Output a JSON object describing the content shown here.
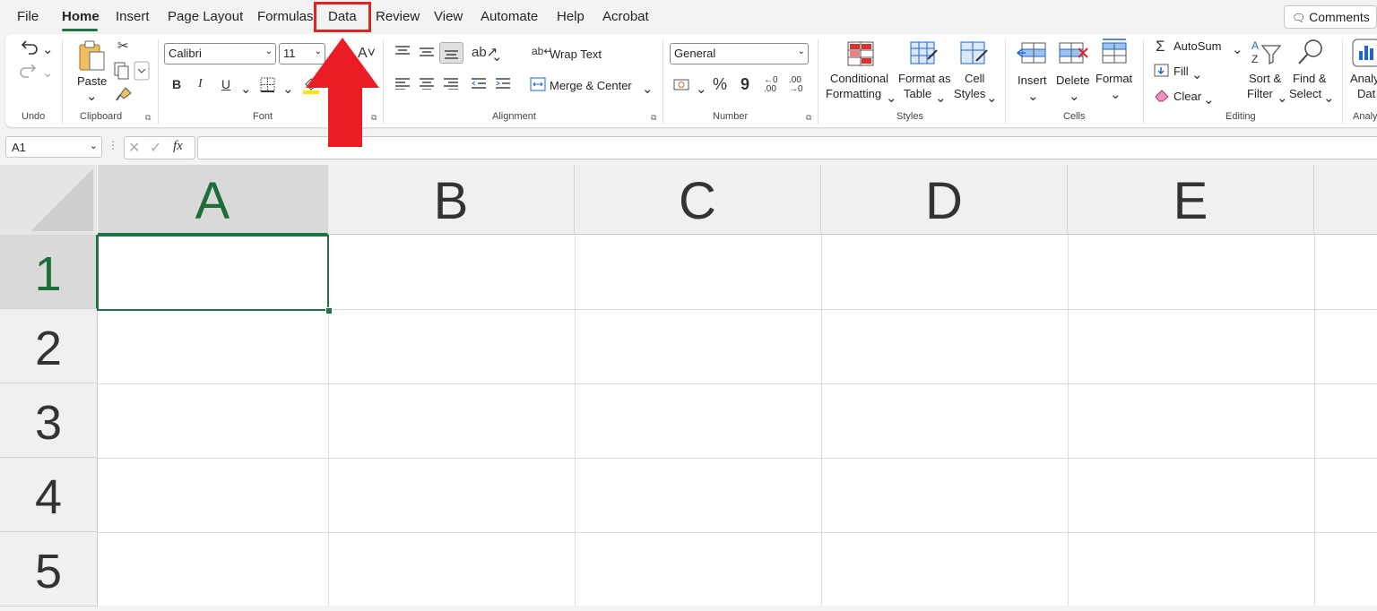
{
  "tabs": [
    "File",
    "Home",
    "Insert",
    "Page Layout",
    "Formulas",
    "Data",
    "Review",
    "View",
    "Automate",
    "Help",
    "Acrobat"
  ],
  "active_tab": "Home",
  "highlighted_tab": "Data",
  "comments_label": "Comments",
  "ribbon": {
    "groups": [
      "Undo",
      "Clipboard",
      "Font",
      "Alignment",
      "Number",
      "Styles",
      "Cells",
      "Editing",
      "Analy"
    ],
    "clipboard": {
      "paste": "Paste"
    },
    "font": {
      "name": "Calibri",
      "size": "11",
      "bold": "B",
      "italic": "I",
      "underline": "U"
    },
    "alignment": {
      "wrap": "Wrap Text",
      "merge": "Merge & Center"
    },
    "number": {
      "format": "General",
      "percent": "%",
      "comma": "9",
      "inc_dec": ".0\n.00",
      "dec_dec": ".00\n→.0"
    },
    "styles": {
      "conditional_1": "Conditional",
      "conditional_2": "Formatting",
      "format_as_1": "Format as",
      "format_as_2": "Table",
      "cell_styles_1": "Cell",
      "cell_styles_2": "Styles"
    },
    "cells": {
      "insert": "Insert",
      "delete": "Delete",
      "format": "Format"
    },
    "editing": {
      "autosum": "AutoSum",
      "fill": "Fill",
      "clear": "Clear",
      "sort_1": "Sort &",
      "sort_2": "Filter",
      "find_1": "Find &",
      "find_2": "Select"
    },
    "analyze": {
      "line1": "Analy",
      "line2": "Dat"
    }
  },
  "formula_bar": {
    "name_box": "A1",
    "fx": "fx",
    "value": ""
  },
  "columns": [
    "A",
    "B",
    "C",
    "D",
    "E"
  ],
  "rows": [
    "1",
    "2",
    "3",
    "4",
    "5"
  ],
  "selected_cell": "A1",
  "colors": {
    "accent": "#217346",
    "annotation": "#e02424"
  }
}
